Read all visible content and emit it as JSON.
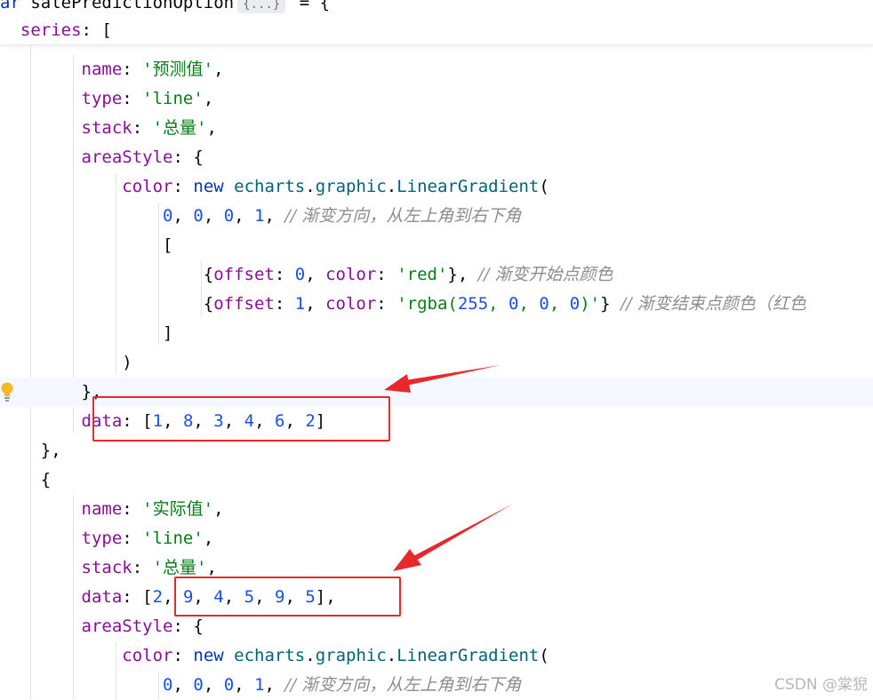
{
  "editor": {
    "sticky": {
      "partial_keyword": "ar",
      "var_name": "salePredictionOption",
      "fold_hint": "{...}",
      "tail": " = {",
      "series_key": "series",
      "series_tail": ": ["
    },
    "s1": {
      "name_key": "name",
      "name_val": "'预测值'",
      "type_key": "type",
      "type_val": "'line'",
      "stack_key": "stack",
      "stack_val": "'总量'",
      "area_key": "areaStyle",
      "color_key": "color",
      "new_kw": "new",
      "obj": "echarts",
      "ns": "graphic",
      "fn": "LinearGradient",
      "dir_nums": [
        "0",
        "0",
        "0",
        "1"
      ],
      "dir_comment": "// 渐变方向，从左上角到右下角",
      "stop1_offset_key": "offset",
      "stop1_offset": "0",
      "stop1_color_key": "color",
      "stop1_color": "'red'",
      "stop1_comment": "// 渐变开始点颜色",
      "stop2_offset_key": "offset",
      "stop2_offset": "1",
      "stop2_color_key": "color",
      "stop2_color_open": "'rgba(",
      "stop2_nums": [
        "255",
        "0",
        "0",
        "0"
      ],
      "stop2_color_close": ")'",
      "stop2_comment": "// 渐变结束点颜色（红色",
      "data_key": "data",
      "data_vals": [
        "1",
        "8",
        "3",
        "4",
        "6",
        "2"
      ]
    },
    "s2": {
      "name_key": "name",
      "name_val": "'实际值'",
      "type_key": "type",
      "type_val": "'line'",
      "stack_key": "stack",
      "stack_val": "'总量'",
      "data_key": "data",
      "data_vals": [
        "2",
        "9",
        "4",
        "5",
        "9",
        "5"
      ],
      "area_key": "areaStyle",
      "color_key": "color",
      "new_kw": "new",
      "obj": "echarts",
      "ns": "graphic",
      "fn": "LinearGradient",
      "dir_nums": [
        "0",
        "0",
        "0",
        "1"
      ],
      "dir_comment": "// 渐变方向，从左上角到右下角"
    }
  },
  "watermark": "CSDN @棠猊",
  "colors": {
    "annotation_red": "#e8282b",
    "keyword": "#0033b3",
    "property": "#871094",
    "string": "#067d17",
    "number": "#1750eb",
    "comment": "#8c8c8c"
  },
  "icons": {
    "bulb": "intention-bulb-icon"
  }
}
